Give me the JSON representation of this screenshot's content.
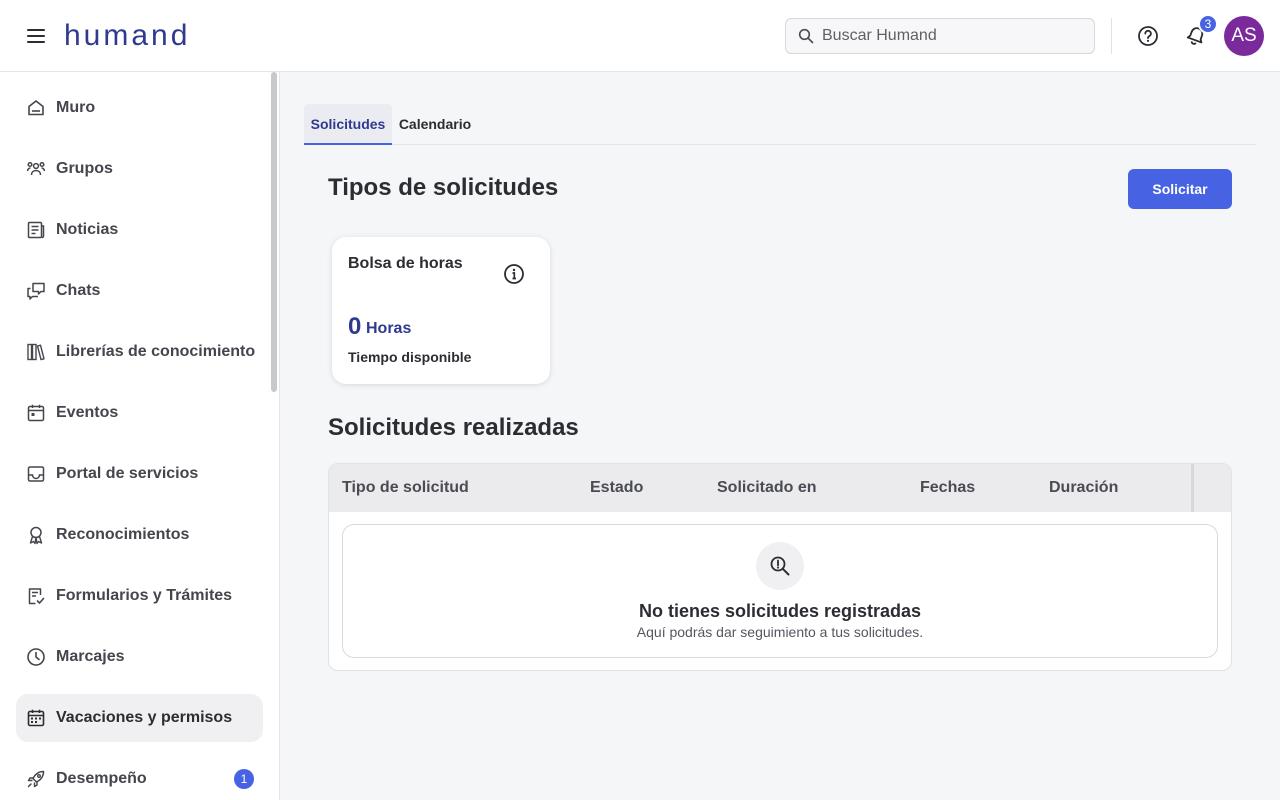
{
  "header": {
    "logo": "humand",
    "search_placeholder": "Buscar Humand",
    "notifications_count": "3",
    "avatar_initials": "AS",
    "icons": {
      "menu": "hamburger-icon",
      "search": "search-icon",
      "help": "help-circle-icon",
      "notifications": "bell-icon"
    }
  },
  "sidebar": {
    "items": [
      {
        "label": "Muro",
        "icon": "home-icon"
      },
      {
        "label": "Grupos",
        "icon": "groups-icon"
      },
      {
        "label": "Noticias",
        "icon": "news-icon"
      },
      {
        "label": "Chats",
        "icon": "chats-icon"
      },
      {
        "label": "Librerías de conocimiento",
        "icon": "library-icon"
      },
      {
        "label": "Eventos",
        "icon": "calendar-icon"
      },
      {
        "label": "Portal de servicios",
        "icon": "inbox-icon"
      },
      {
        "label": "Reconocimientos",
        "icon": "award-icon"
      },
      {
        "label": "Formularios y Trámites",
        "icon": "form-check-icon"
      },
      {
        "label": "Marcajes",
        "icon": "clock-icon"
      },
      {
        "label": "Vacaciones y permisos",
        "icon": "calendar-grid-icon",
        "active": true
      },
      {
        "label": "Desempeño",
        "icon": "rocket-icon",
        "badge": "1"
      }
    ]
  },
  "tabs": [
    {
      "label": "Solicitudes",
      "active": true
    },
    {
      "label": "Calendario",
      "active": false
    }
  ],
  "types_section": {
    "title": "Tipos de solicitudes",
    "action_label": "Solicitar",
    "card": {
      "title": "Bolsa de horas",
      "value": "0",
      "unit": "Horas",
      "caption": "Tiempo disponible",
      "info_icon": "info-icon"
    }
  },
  "requests_section": {
    "title": "Solicitudes realizadas",
    "columns": [
      "Tipo de solicitud",
      "Estado",
      "Solicitado en",
      "Fechas",
      "Duración"
    ],
    "rows": [],
    "empty_state": {
      "icon": "search-zoom-icon",
      "title": "No tienes solicitudes registradas",
      "subtitle": "Aquí podrás dar seguimiento a tus solicitudes."
    }
  },
  "colors": {
    "brand": "#2f3a8f",
    "accent": "#4763e4",
    "avatar": "#7b2a9b"
  }
}
